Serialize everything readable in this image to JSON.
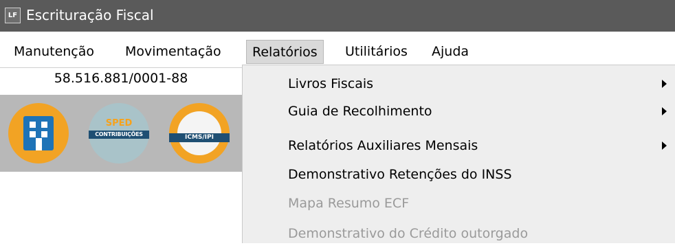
{
  "window": {
    "app_icon_text": "LF",
    "title": "Escrituração Fiscal"
  },
  "menubar": {
    "items": [
      {
        "label": "Manutenção"
      },
      {
        "label": "Movimentação"
      },
      {
        "label": "Relatórios"
      },
      {
        "label": "Utilitários"
      },
      {
        "label": "Ajuda"
      }
    ],
    "active": "Relatórios"
  },
  "company": {
    "cnpj": "58.516.881/0001-88"
  },
  "modules": [
    {
      "icon": "building-icon"
    },
    {
      "icon": "sped-contribuicoes-icon",
      "title": "SPED",
      "banner": "CONTRIBUIÇÕES"
    },
    {
      "icon": "icms-ipi-icon",
      "banner": "ICMS/IPI"
    }
  ],
  "relatorios_menu": {
    "items": [
      {
        "label": "Livros Fiscais",
        "has_submenu": true,
        "enabled": true
      },
      {
        "label": "Guia de Recolhimento",
        "has_submenu": true,
        "enabled": true
      },
      {
        "label": "Relatórios Auxiliares Mensais",
        "has_submenu": true,
        "enabled": true
      },
      {
        "label": "Demonstrativo Retenções do INSS",
        "has_submenu": false,
        "enabled": true
      },
      {
        "label": "Mapa Resumo ECF",
        "has_submenu": false,
        "enabled": false
      },
      {
        "label": "Demonstrativo do Crédito outorgado",
        "has_submenu": false,
        "enabled": false
      }
    ]
  },
  "colors": {
    "titlebar": "#5a5a5a",
    "active_menu": "#d9d9d9",
    "disabled_text": "#9a9a9a",
    "orange": "#f2a324",
    "blue": "#1e73b7"
  }
}
